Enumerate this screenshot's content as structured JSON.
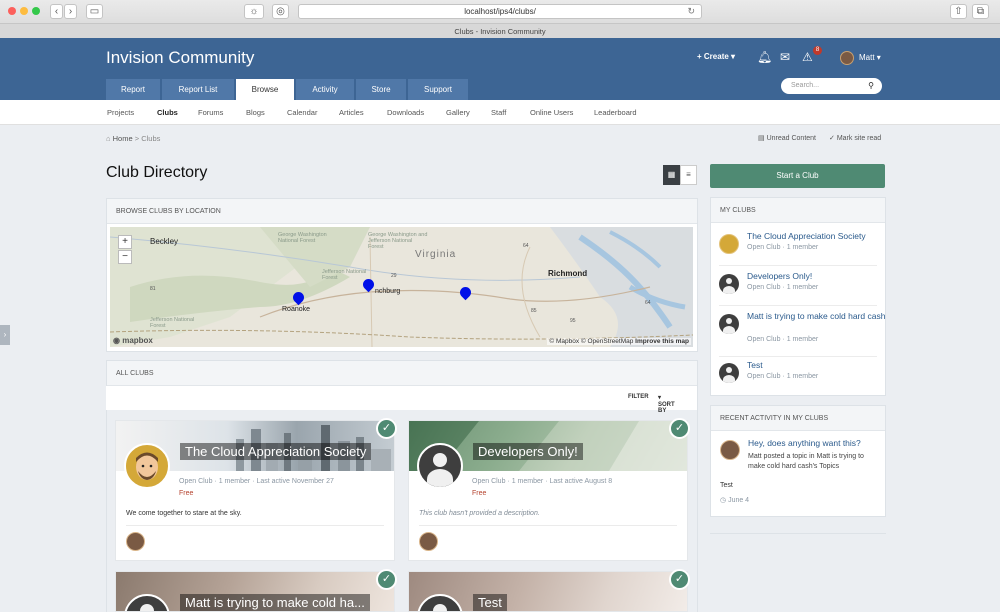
{
  "browser": {
    "url": "localhost/ips4/clubs/",
    "tab_title": "Clubs - Invision Community"
  },
  "header": {
    "site_title": "Invision Community",
    "create_label": "Create",
    "user_name": "Matt",
    "notification_count": "8",
    "tabs": [
      {
        "label": "Report"
      },
      {
        "label": "Report List"
      },
      {
        "label": "Browse"
      },
      {
        "label": "Activity"
      },
      {
        "label": "Store"
      },
      {
        "label": "Support"
      }
    ],
    "search_placeholder": "Search..."
  },
  "subnav": {
    "items": [
      {
        "label": "Projects"
      },
      {
        "label": "Clubs"
      },
      {
        "label": "Forums"
      },
      {
        "label": "Blogs"
      },
      {
        "label": "Calendar"
      },
      {
        "label": "Articles"
      },
      {
        "label": "Downloads"
      },
      {
        "label": "Gallery"
      },
      {
        "label": "Staff"
      },
      {
        "label": "Online Users"
      },
      {
        "label": "Leaderboard"
      }
    ]
  },
  "breadcrumb": {
    "home": "Home",
    "sep": ">",
    "current": "Clubs",
    "unread_content": "Unread Content",
    "mark_read": "Mark site read"
  },
  "page": {
    "title": "Club Directory",
    "start_club": "Start a Club"
  },
  "map": {
    "heading": "BROWSE CLUBS BY LOCATION",
    "labels": {
      "beckley": "Beckley",
      "virginia": "Virginia",
      "richmond": "Richmond",
      "roanoke": "Roanoke",
      "lynchburg": "nchburg",
      "small1": "George Washington National Forest",
      "small2": "George Washington and Jefferson National Forest",
      "small3": "Jefferson National Forest",
      "small4": "Jefferson National Forest"
    },
    "route_labels": [
      "81",
      "29",
      "64",
      "85",
      "95",
      "64"
    ],
    "attribution": "© Mapbox © OpenStreetMap",
    "improve": "Improve this map",
    "logo": "mapbox",
    "zoom_in": "+",
    "zoom_out": "−"
  },
  "all_clubs": {
    "heading": "ALL CLUBS",
    "filter": "FILTER",
    "sort_by": "SORT BY",
    "clubs": [
      {
        "name": "The Cloud Appreciation Society",
        "type": "Open Club",
        "members": "1 member",
        "last_active": "Last active November 27",
        "price": "Free",
        "description": "We come together to stare at the sky."
      },
      {
        "name": "Developers Only!",
        "type": "Open Club",
        "members": "1 member",
        "last_active": "Last active August 8",
        "price": "Free",
        "description": "This club hasn't provided a description."
      },
      {
        "name": "Matt is trying to make cold ha..."
      },
      {
        "name": "Test"
      }
    ]
  },
  "my_clubs": {
    "heading": "MY CLUBS",
    "items": [
      {
        "name": "The Cloud Appreciation Society",
        "type": "Open Club",
        "members": "1 member"
      },
      {
        "name": "Developers Only!",
        "type": "Open Club",
        "members": "1 member"
      },
      {
        "name": "Matt is trying to make cold hard cash",
        "type": "Open Club",
        "members": "1 member"
      },
      {
        "name": "Test",
        "type": "Open Club",
        "members": "1 member"
      }
    ]
  },
  "recent_activity": {
    "heading": "RECENT ACTIVITY IN MY CLUBS",
    "title": "Hey, does anything want this?",
    "summary": "Matt posted a topic in Matt is trying to make cold hard cash's Topics",
    "excerpt": "Test",
    "date": "June 4"
  },
  "meta_sep": "·",
  "colors": {
    "header": "#3d6594",
    "accent": "#4f8a73",
    "link": "#2a5a8c"
  }
}
